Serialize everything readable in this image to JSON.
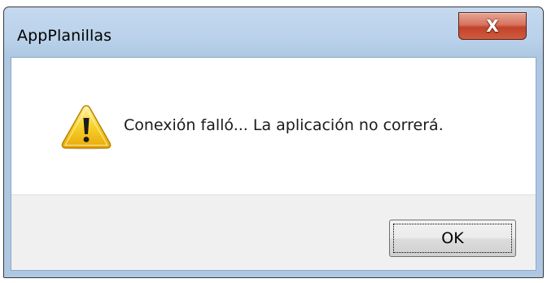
{
  "window": {
    "title": "AppPlanillas"
  },
  "titlebar": {
    "close_icon": "close-icon",
    "close_glyph": "X",
    "close_color": "#c7472e"
  },
  "message": {
    "icon": "warning-icon",
    "text": "Conexión falló... La aplicación no correrá."
  },
  "buttons": {
    "ok_label": "OK"
  }
}
